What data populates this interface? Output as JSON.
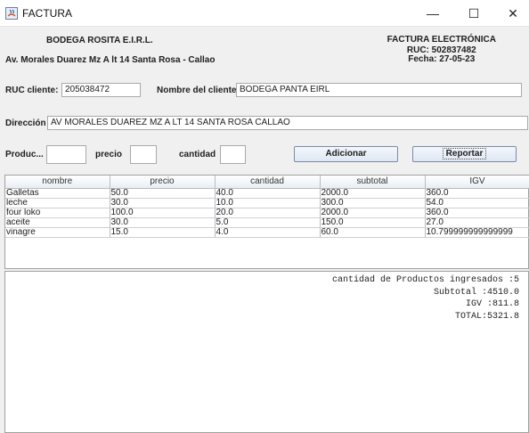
{
  "window": {
    "title": "FACTURA",
    "minimize": "—",
    "maximize": "☐",
    "close": "✕"
  },
  "header": {
    "company": "BODEGA ROSITA E.I.R.L.",
    "address": "Av. Morales Duarez Mz A lt 14 Santa Rosa - Callao",
    "invoice_title": "FACTURA ELECTRÓNICA",
    "ruc": "RUC: 502837482",
    "fecha": "Fecha: 27-05-23"
  },
  "client": {
    "ruc_label": "RUC cliente:",
    "ruc_value": "205038472",
    "name_label": "Nombre del cliente:",
    "name_value": "BODEGA PANTA EIRL",
    "address_label": "Dirección",
    "address_value": "AV MORALES DUAREZ MZ A LT 14 SANTA ROSA CALLAO"
  },
  "entry": {
    "product_label": "Produc...",
    "product_value": "",
    "price_label": "precio",
    "price_value": "",
    "qty_label": "cantidad",
    "qty_value": "",
    "add_button": "Adicionar",
    "report_button": "Reportar"
  },
  "table": {
    "headers": [
      "nombre",
      "precio",
      "cantidad",
      "subtotal",
      "IGV"
    ],
    "rows": [
      [
        "Galletas",
        "50.0",
        "40.0",
        "2000.0",
        "360.0"
      ],
      [
        "leche",
        "30.0",
        "10.0",
        "300.0",
        "54.0"
      ],
      [
        "four loko",
        "100.0",
        "20.0",
        "2000.0",
        "360.0"
      ],
      [
        "aceite",
        "30.0",
        "5.0",
        "150.0",
        "27.0"
      ],
      [
        "vinagre",
        "15.0",
        "4.0",
        "60.0",
        "10.799999999999999"
      ]
    ]
  },
  "summary": {
    "count": "cantidad de Productos ingresados :5",
    "subtotal": "Subtotal :4510.0",
    "igv": "IGV :811.8",
    "total": "TOTAL:5321.8"
  }
}
